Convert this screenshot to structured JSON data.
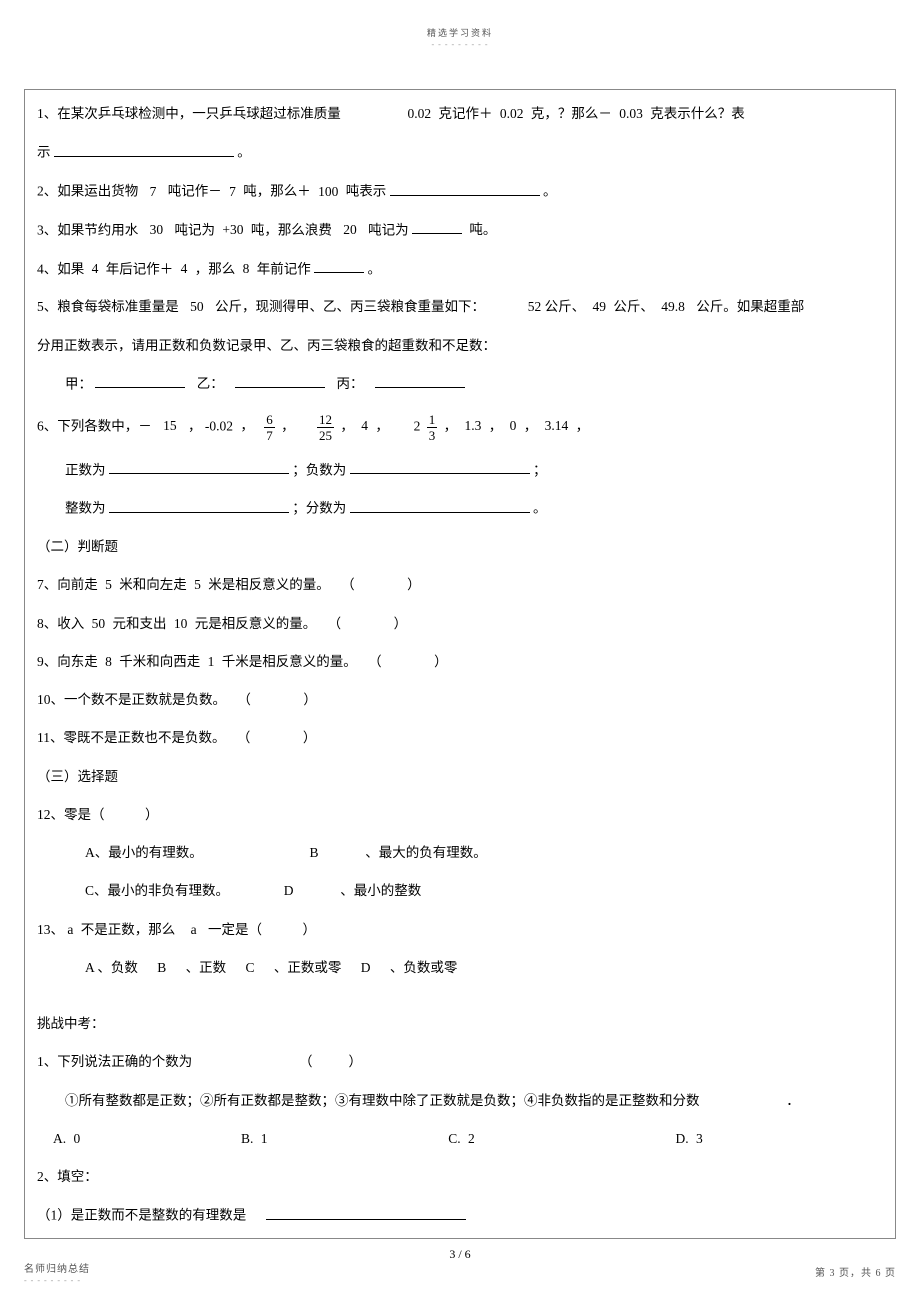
{
  "header_small": "精选学习资料",
  "dash_row": "- - - - - - - - -",
  "q1": {
    "prefix": "1、在某次乒乓球检测中，一只乒乓球超过标准质量",
    "n1": "0.02",
    "mid1": "克记作＋",
    "n2": "0.02",
    "mid2": "克，？那么－",
    "n3": "0.03",
    "tail": "克表示什么？表",
    "line2a": "示",
    "line2b": "。"
  },
  "q2": {
    "prefix": "2、如果运出货物",
    "n1": "7",
    "mid1": "吨记作－",
    "n2": "7",
    "mid2": "吨，那么＋",
    "n3": "100",
    "mid3": "吨表示",
    "tail": "。"
  },
  "q3": {
    "prefix": "3、如果节约用水",
    "n1": "30",
    "mid1": "吨记为",
    "n2": "+30",
    "mid2": "吨，那么浪费",
    "n3": "20",
    "mid3": "吨记为",
    "unit": "吨。"
  },
  "q4": {
    "prefix": "4、如果",
    "n1": "4",
    "mid1": "年后记作＋",
    "n2": "4",
    "mid2": "，那么",
    "n3": "8",
    "mid3": "年前记作",
    "tail": "。"
  },
  "q5": {
    "prefix": "5、粮食每袋标准重量是",
    "n1": "50",
    "mid1": "公斤，现测得甲、乙、丙三袋粮食重量如下：",
    "a": "52",
    "un1": "公斤、",
    "b": "49",
    "un2": "公斤、",
    "c": "49.8",
    "un3": "公斤。如果超重部",
    "line2": "分用正数表示，请用正数和负数记录甲、乙、丙三袋粮食的超重数和不足数：",
    "l3_jia": "甲：",
    "l3_yi": "乙：",
    "l3_bing": "丙："
  },
  "q6": {
    "prefix": "6、下列各数中，－",
    "n1": "15",
    "comma1": "，",
    "n2": "-0.02",
    "comma2": "，",
    "f1_num": "6",
    "f1_den": "7",
    "comma3": "，",
    "f2_num": "12",
    "f2_den": "25",
    "comma4": "，",
    "n3": "4",
    "comma5": "，",
    "mix_whole": "2",
    "mix_num": "1",
    "mix_den": "3",
    "comma6": "，",
    "n4": "1.3",
    "comma7": "，",
    "n5": "0",
    "comma8": "，",
    "n6": "3.14",
    "comma9": "，",
    "l2a": "正数为",
    "l2b": "；负数为",
    "l2c": "；",
    "l3a": "整数为",
    "l3b": "；分数为",
    "l3c": "。"
  },
  "sec2": "（二）判断题",
  "q7": {
    "text": "7、向前走",
    "n1": "5",
    "mid1": "米和向左走",
    "n2": "5",
    "tail": "米是相反意义的量。",
    "paren": "（　　　）"
  },
  "q8": {
    "text": "8、收入",
    "n1": "50",
    "mid1": "元和支出",
    "n2": "10",
    "tail": "元是相反意义的量。",
    "paren": "（　　　）"
  },
  "q9": {
    "text": "9、向东走",
    "n1": "8",
    "mid1": "千米和向西走",
    "n2": "1",
    "tail": "千米是相反意义的量。",
    "paren": "（　　　）"
  },
  "q10": {
    "text": "10、一个数不是正数就是负数。",
    "paren": "（　　　）"
  },
  "q11": {
    "text": "11、零既不是正数也不是负数。",
    "paren": "（　　　）"
  },
  "sec3": "（三）选择题",
  "q12": {
    "stem": "12、零是（　　　）",
    "A": "A、最小的有理数。",
    "Bk": "B",
    "Btxt": "、最大的负有理数。",
    "C": "C、最小的非负有理数。",
    "Dk": "D",
    "Dtxt": "、最小的整数"
  },
  "q13": {
    "p1": "13、",
    "var": "a",
    "p2": "不是正数，那么",
    "var2": "a",
    "p3": "一定是（　　　）",
    "Ak": "A",
    "Atxt": "、负数",
    "Bk": "B",
    "Btxt": "、正数",
    "Ck": "C",
    "Ctxt": "、正数或零",
    "Dk": "D",
    "Dtxt": "、负数或零"
  },
  "challenge": "挑战中考：",
  "c1": {
    "stem": "1、下列说法正确的个数为",
    "paren": "（　　）",
    "opts": "①所有整数都是正数；②所有正数都是整数；③有理数中除了正数就是负数；④非负数指的是正整数和分数",
    "dot": "．",
    "A": "A.",
    "A_n": "0",
    "B": "B.",
    "B_n": "1",
    "C": "C.",
    "C_n": "2",
    "D": "D.",
    "D_n": "3"
  },
  "c2": {
    "head": "2、填空：",
    "sub1": "（1）是正数而不是整数的有理数是"
  },
  "page_num": "3  /  6",
  "footer_left": "名师归纳总结",
  "footer_left_dash": "- - - - - - - - -",
  "footer_right": "第 3 页，共 6 页"
}
